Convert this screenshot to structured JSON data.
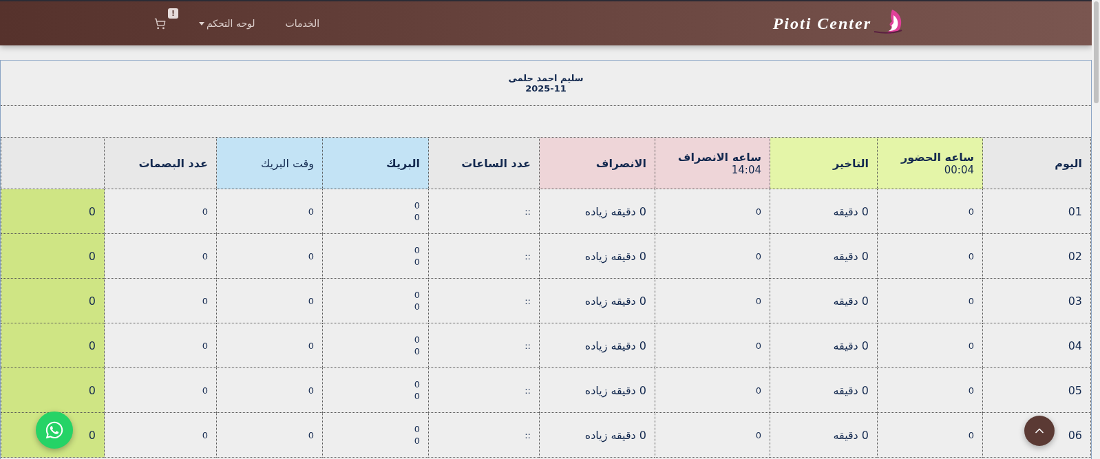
{
  "navbar": {
    "logo": "Pioti Center",
    "links": [
      {
        "label": "الخدمات",
        "kind": "link"
      },
      {
        "label": "لوحه التحكم",
        "kind": "dropdown"
      }
    ],
    "cart": {
      "badge": "!"
    }
  },
  "report": {
    "employee": "سليم احمد حلمى",
    "month": "2025-11"
  },
  "table": {
    "columns": [
      {
        "label": "اليوم",
        "color": "#e8e8e8",
        "bold": true,
        "large": true
      },
      {
        "label": "ساعه الحضور",
        "sub": "00:04",
        "color": "#e4f5a8",
        "bold": true,
        "large": false
      },
      {
        "label": "التاخير",
        "color": "#e4f5a8",
        "bold": true,
        "large": true
      },
      {
        "label": "ساعه الانصراف",
        "sub": "14:04",
        "color": "#eed5d8",
        "bold": true,
        "large": false
      },
      {
        "label": "الانصراف",
        "color": "#eed5d8",
        "bold": true,
        "large": true
      },
      {
        "label": "عدد الساعات",
        "color": "#e8e8e8",
        "bold": true,
        "large": false
      },
      {
        "label": "البريك",
        "color": "#c3e3f5",
        "bold": true,
        "large": false
      },
      {
        "label": "وقت البريك",
        "color": "#c3e3f5",
        "bold": false,
        "large": false
      },
      {
        "label": "عدد البصمات",
        "color": "#e8e8e8",
        "bold": true,
        "large": false
      },
      {
        "color": "#e8e8e8",
        "body": {
          "color": "#cfe584"
        },
        "large": true
      }
    ],
    "rows": [
      {
        "cells": [
          "01",
          "0",
          "0 دقيقه",
          "0",
          "0 دقيقه زياده",
          "::",
          [
            "0",
            "0"
          ],
          "0",
          "0",
          "0"
        ]
      },
      {
        "cells": [
          "02",
          "0",
          "0 دقيقه",
          "0",
          "0 دقيقه زياده",
          "::",
          [
            "0",
            "0"
          ],
          "0",
          "0",
          "0"
        ]
      },
      {
        "cells": [
          "03",
          "0",
          "0 دقيقه",
          "0",
          "0 دقيقه زياده",
          "::",
          [
            "0",
            "0"
          ],
          "0",
          "0",
          "0"
        ]
      },
      {
        "cells": [
          "04",
          "0",
          "0 دقيقه",
          "0",
          "0 دقيقه زياده",
          "::",
          [
            "0",
            "0"
          ],
          "0",
          "0",
          "0"
        ]
      },
      {
        "cells": [
          "05",
          "0",
          "0 دقيقه",
          "0",
          "0 دقيقه زياده",
          "::",
          [
            "0",
            "0"
          ],
          "0",
          "0",
          "0"
        ]
      },
      {
        "cells": [
          "06",
          "0",
          "0 دقيقه",
          "0",
          "0 دقيقه زياده",
          "::",
          [
            "0",
            "0"
          ],
          "0",
          "0",
          "0"
        ]
      }
    ]
  }
}
